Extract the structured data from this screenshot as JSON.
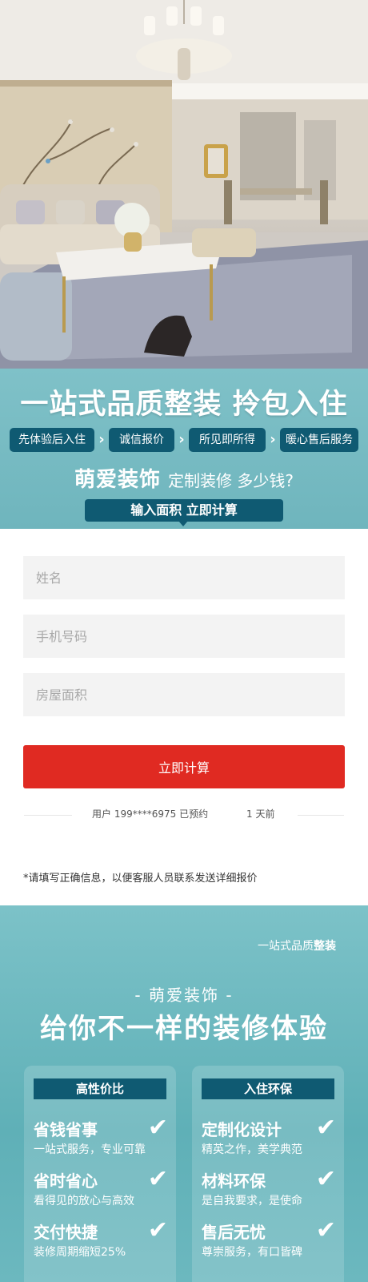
{
  "hero": {
    "image_description_icon": "luxury-living-room-photo"
  },
  "promo": {
    "title": "一站式品质整装  拎包入住",
    "features": [
      "先体验后入住",
      "诚信报价",
      "所见即所得",
      "暖心售后服务"
    ],
    "brand": "萌爱装饰",
    "brand_sub": "定制装修 多少钱?",
    "cta": "输入面积  立即计算"
  },
  "form": {
    "name_placeholder": "姓名",
    "phone_placeholder": "手机号码",
    "area_placeholder": "房屋面积",
    "submit_label": "立即计算",
    "booking_text": "用户 199****6975 已预约",
    "booking_time": "1 天前",
    "notice": "*请填写正确信息，以便客服人员联系发送详细报价"
  },
  "experience": {
    "corner_prefix": "一站式品质",
    "corner_bold": "整装",
    "brand": "- 萌爱装饰 -",
    "title": "给你不一样的装修体验",
    "cards": [
      {
        "heading": "高性价比",
        "items": [
          {
            "title": "省钱省事",
            "desc": "一站式服务，专业可靠"
          },
          {
            "title": "省时省心",
            "desc": "看得见的放心与高效"
          },
          {
            "title": "交付快捷",
            "desc": "装修周期缩短25%"
          }
        ]
      },
      {
        "heading": "入住环保",
        "items": [
          {
            "title": "定制化设计",
            "desc": "精英之作，美学典范"
          },
          {
            "title": "材料环保",
            "desc": "是自我要求，是使命"
          },
          {
            "title": "售后无忧",
            "desc": "尊崇服务，有口皆碑"
          }
        ]
      }
    ]
  },
  "colors": {
    "teal": "#6fb5bd",
    "navy": "#0f5a72",
    "red": "#e02a22",
    "field": "#f3f3f3"
  }
}
